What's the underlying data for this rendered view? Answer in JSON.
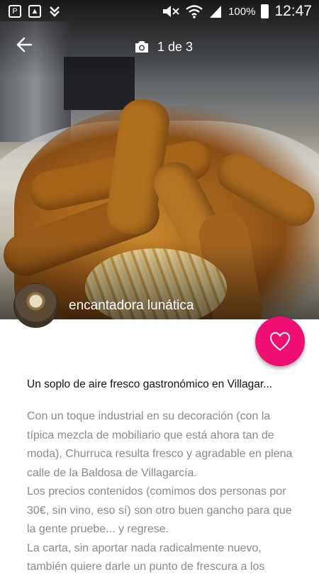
{
  "status_bar": {
    "battery_percent": "100%",
    "time": "12:47",
    "icons": [
      "p-app-icon",
      "gallery-icon",
      "download-check-icon",
      "mute-icon",
      "wifi-icon",
      "signal-icon",
      "battery-icon"
    ]
  },
  "header": {
    "photo_counter": "1 de 3",
    "icons": [
      "back-arrow-icon",
      "camera-icon"
    ]
  },
  "author": {
    "name": "encantadora lunática"
  },
  "fab": {
    "icon": "heart-outline-icon",
    "color": "#ef0f72"
  },
  "article": {
    "title": "Un soplo de aire fresco gastronómico en Villagar...",
    "paragraphs": [
      "Con un toque industrial en su decoración (con la típica mezcla de mobiliario que está ahora tan de moda), Churruca resulta fresco y agradable en plena calle de la Baldosa de Villagarcía.",
      "Los precios contenidos (comimos dos personas por 30€, sin vino, eso sí) son otro buen gancho para que la gente pruebe... y regrese.",
      "La carta, sin aportar nada radicalmente nuevo, también quiere darle un punto de frescura a los"
    ]
  }
}
